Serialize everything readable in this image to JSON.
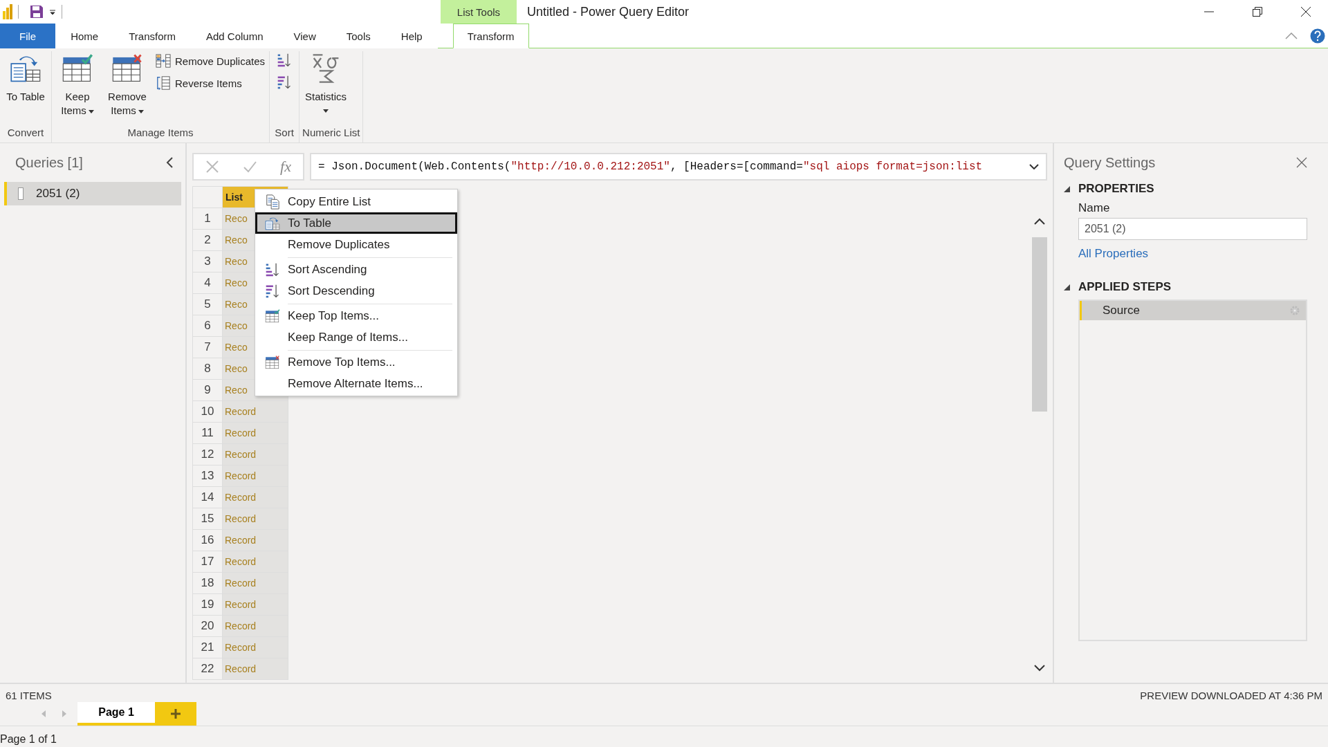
{
  "title_bar": {
    "context_group": "List Tools",
    "title": "Untitled - Power Query Editor"
  },
  "ribbon_tabs": [
    {
      "label": "File",
      "kind": "file",
      "selected": false
    },
    {
      "label": "Home",
      "kind": "tab",
      "selected": false
    },
    {
      "label": "Transform",
      "kind": "tab",
      "selected": false
    },
    {
      "label": "Add Column",
      "kind": "tab",
      "selected": false
    },
    {
      "label": "View",
      "kind": "tab",
      "selected": false
    },
    {
      "label": "Tools",
      "kind": "tab",
      "selected": false
    },
    {
      "label": "Help",
      "kind": "tab",
      "selected": false
    },
    {
      "label": "Transform",
      "kind": "context",
      "selected": true
    }
  ],
  "ribbon_groups": [
    {
      "label": "Convert",
      "buttons": [
        {
          "label": "To Table",
          "kind": "to-table"
        }
      ]
    },
    {
      "label": "Manage Items",
      "buttons": [
        {
          "label": "Keep Items",
          "kind": "keep"
        },
        {
          "label": "Remove Items",
          "kind": "remove"
        },
        {
          "label": "Remove Duplicates",
          "kind": "dedupe"
        },
        {
          "label": "Reverse Items",
          "kind": "reverse"
        }
      ]
    },
    {
      "label": "Sort",
      "buttons": [
        {
          "kind": "sort-asc"
        },
        {
          "kind": "sort-desc"
        }
      ]
    },
    {
      "label": "Numeric List",
      "buttons": [
        {
          "label": "Statistics",
          "kind": "statistics"
        }
      ]
    }
  ],
  "queries_pane": {
    "title": "Queries [1]",
    "items": [
      {
        "label": "2051 (2)",
        "selected": true
      }
    ]
  },
  "formula_bar": {
    "function_label": "fx",
    "segments": [
      {
        "kind": "code",
        "text": "= Json.Document(Web.Contents("
      },
      {
        "kind": "string",
        "text": "\"http://10.0.0.212:2051\""
      },
      {
        "kind": "code",
        "text": ", [Headers=[command="
      },
      {
        "kind": "string",
        "text": "\"sql aiops format=json:list"
      }
    ]
  },
  "grid": {
    "column_header": "List",
    "rows": [
      {
        "number": "1",
        "value": "Reco"
      },
      {
        "number": "2",
        "value": "Reco"
      },
      {
        "number": "3",
        "value": "Reco"
      },
      {
        "number": "4",
        "value": "Reco"
      },
      {
        "number": "5",
        "value": "Reco"
      },
      {
        "number": "6",
        "value": "Reco"
      },
      {
        "number": "7",
        "value": "Reco"
      },
      {
        "number": "8",
        "value": "Reco"
      },
      {
        "number": "9",
        "value": "Reco"
      },
      {
        "number": "10",
        "value": "Record"
      },
      {
        "number": "11",
        "value": "Record"
      },
      {
        "number": "12",
        "value": "Record"
      },
      {
        "number": "13",
        "value": "Record"
      },
      {
        "number": "14",
        "value": "Record"
      },
      {
        "number": "15",
        "value": "Record"
      },
      {
        "number": "16",
        "value": "Record"
      },
      {
        "number": "17",
        "value": "Record"
      },
      {
        "number": "18",
        "value": "Record"
      },
      {
        "number": "19",
        "value": "Record"
      },
      {
        "number": "20",
        "value": "Record"
      },
      {
        "number": "21",
        "value": "Record"
      },
      {
        "number": "22",
        "value": "Record"
      }
    ]
  },
  "context_menu": [
    {
      "label": "Copy Entire List",
      "kind": "copy",
      "separator_before": false,
      "selected": false
    },
    {
      "label": "To Table",
      "kind": "to-table",
      "separator_before": false,
      "selected": true
    },
    {
      "label": "Remove Duplicates",
      "kind": "plain",
      "separator_before": false,
      "selected": false
    },
    {
      "label": "Sort Ascending",
      "kind": "sort-asc",
      "separator_before": true,
      "selected": false
    },
    {
      "label": "Sort Descending",
      "kind": "sort-desc",
      "separator_before": false,
      "selected": false
    },
    {
      "label": "Keep Top Items...",
      "kind": "keep",
      "separator_before": true,
      "selected": false
    },
    {
      "label": "Keep Range of Items...",
      "kind": "plain",
      "separator_before": false,
      "selected": false
    },
    {
      "label": "Remove Top Items...",
      "kind": "remove",
      "separator_before": true,
      "selected": false
    },
    {
      "label": "Remove Alternate Items...",
      "kind": "plain",
      "separator_before": false,
      "selected": false
    }
  ],
  "query_settings": {
    "title": "Query Settings",
    "properties_heading": "PROPERTIES",
    "name_label": "Name",
    "name_value": "2051 (2)",
    "all_properties_link": "All Properties",
    "steps_heading": "APPLIED STEPS",
    "steps": [
      {
        "label": "Source",
        "selected": true
      }
    ]
  },
  "status_bar": {
    "items_count": "61 ITEMS",
    "preview_info": "PREVIEW DOWNLOADED AT 4:36 PM",
    "pages": [
      {
        "label": "Page 1",
        "selected": true
      }
    ],
    "page_info": "Page 1 of 1"
  }
}
